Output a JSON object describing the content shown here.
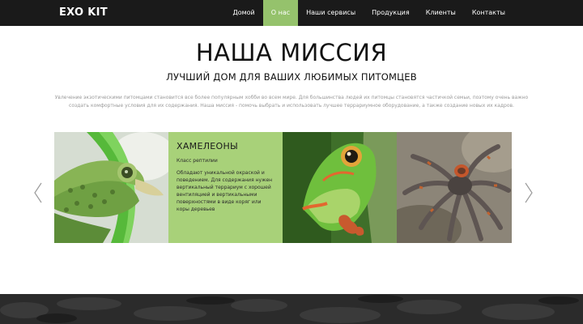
{
  "brand": "EXO KIT",
  "nav": [
    "Домой",
    "О нас",
    "Наши сервисы",
    "Продукция",
    "Клиенты",
    "Контакты"
  ],
  "nav_active": "О нас",
  "hero": {
    "title": "НАША МИССИЯ",
    "subtitle": "ЛУЧШИЙ ДОМ ДЛЯ ВАШИХ ЛЮБИМЫХ ПИТОМЦЕВ",
    "description": "Увлечение экзотическими питомцами становится все более популярным хобби во всем мире. Для большинства людей их питомцы становятся частичкой семьи, поэтому очень важно создать комфортные условия для их содержания. Наша миссия - помочь выбрать и использовать лучшее террариумное оборудование, а также создание новых их кадров."
  },
  "card": {
    "title": "ХАМЕЛЕОНЫ",
    "subtitle": "Класс рептилии",
    "text": "Обладают уникальной окраской и поведением. Для содержания нужен вертикальный террариум с хорошей вентиляцией и вертикальными поверхностями в виде коряг или коры деревьев"
  },
  "colors": {
    "accent": "#95c26c",
    "card_bg": "#a8d179",
    "navbar": "#1a1a1a"
  },
  "icons": {
    "prev": "chevron-left-icon",
    "next": "chevron-right-icon"
  }
}
